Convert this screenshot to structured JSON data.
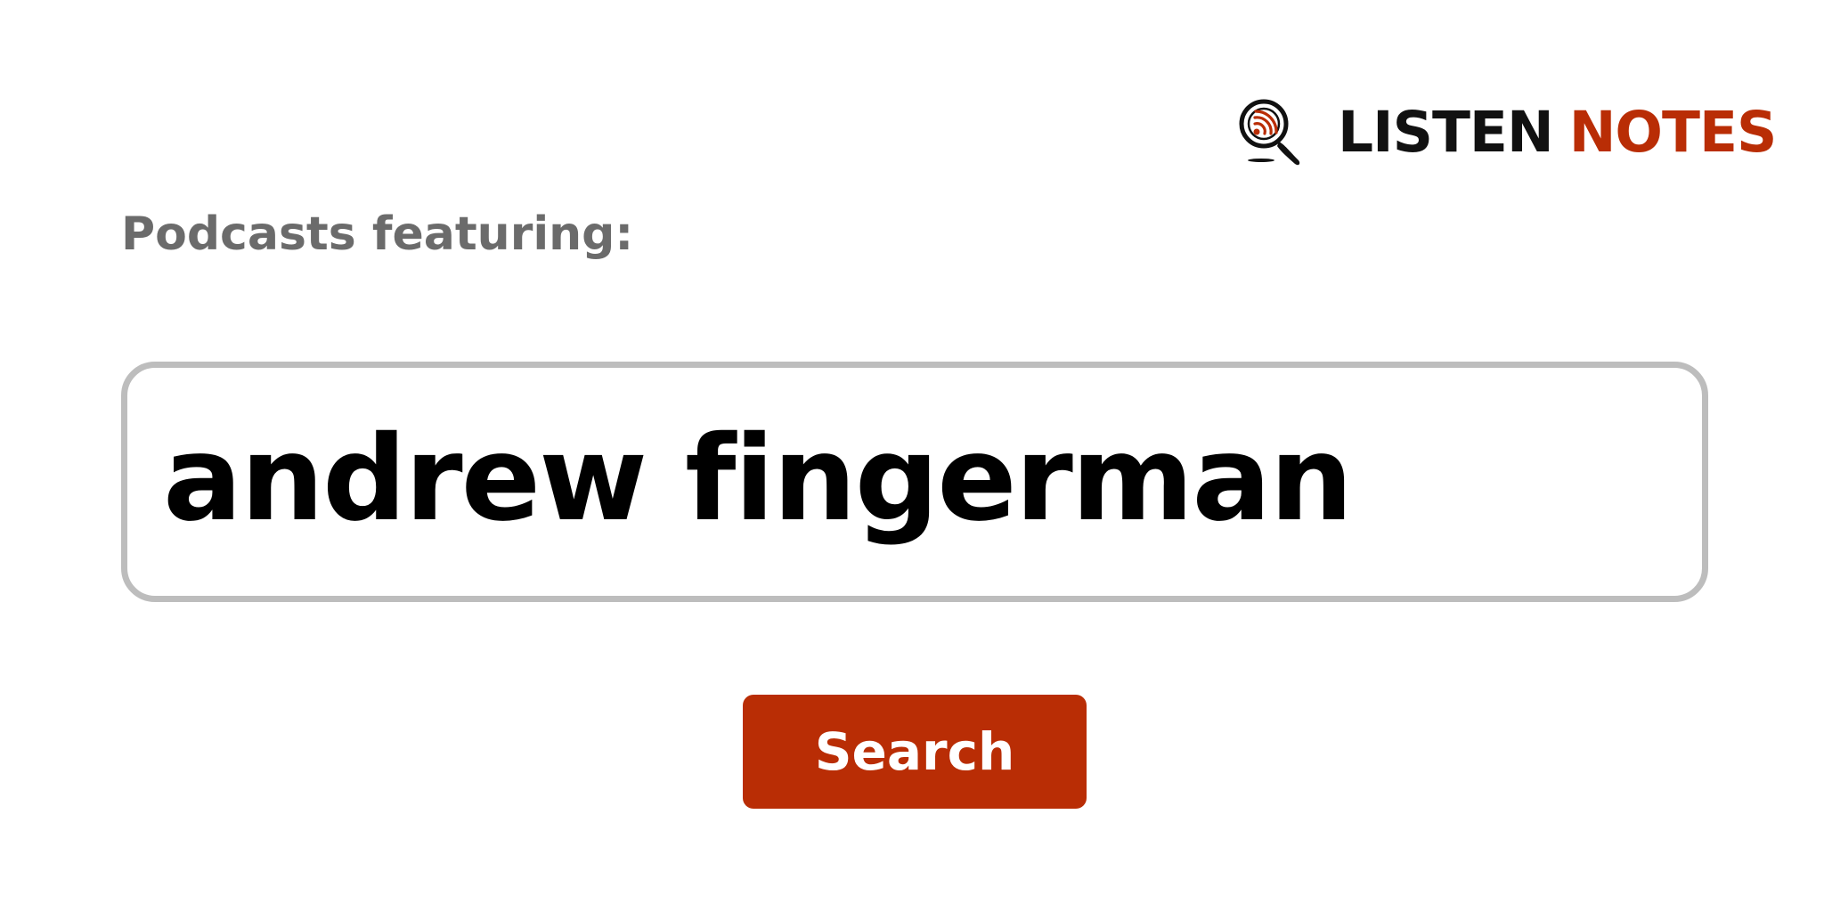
{
  "brand": {
    "icon": "podcast-magnifier-icon",
    "name_part_1": "LISTEN",
    "name_part_2": "NOTES",
    "colors": {
      "accent": "#b92d05",
      "dark": "#111111"
    }
  },
  "heading": "Podcasts featuring:",
  "search": {
    "value": "andrew fingerman",
    "border_color": "#bdbdbd"
  },
  "search_button": {
    "label": "Search",
    "color": "#b92d05"
  }
}
